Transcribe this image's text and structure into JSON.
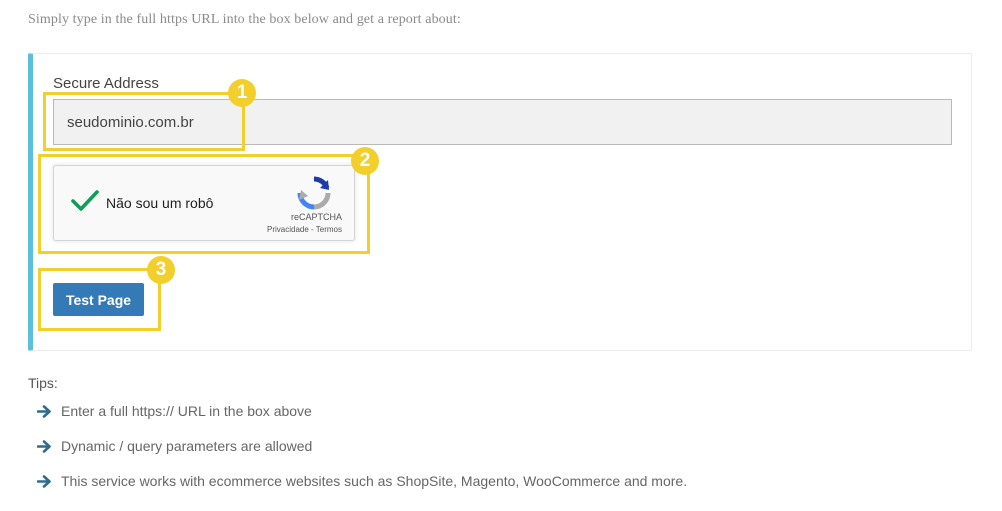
{
  "intro_text": "Simply type in the full https URL into the box below and get a report about:",
  "form": {
    "field_label": "Secure Address",
    "url_value": "seudominio.com.br",
    "submit_label": "Test Page"
  },
  "recaptcha": {
    "label": "Não sou um robô",
    "brand": "reCAPTCHA",
    "privacy": "Privacidade",
    "separator": " - ",
    "terms": "Termos",
    "checked": true
  },
  "annotations": {
    "badge_1": "1",
    "badge_2": "2",
    "badge_3": "3",
    "highlight_color": "#f2cf2a"
  },
  "tips": {
    "title": "Tips:",
    "items": [
      "Enter a full https:// URL in the box above",
      "Dynamic / query parameters are allowed",
      "This service works with ecommerce websites such as ShopSite, Magento, WooCommerce and more."
    ]
  },
  "colors": {
    "accent_bar": "#5bc0de",
    "button": "#337ab7",
    "check": "#0f9d58",
    "arrow": "#2f6a8f"
  },
  "icons": {
    "tip_bullet": "arrow-right-icon",
    "recaptcha_check": "checkmark-icon",
    "recaptcha_logo": "recaptcha-logo-icon"
  }
}
